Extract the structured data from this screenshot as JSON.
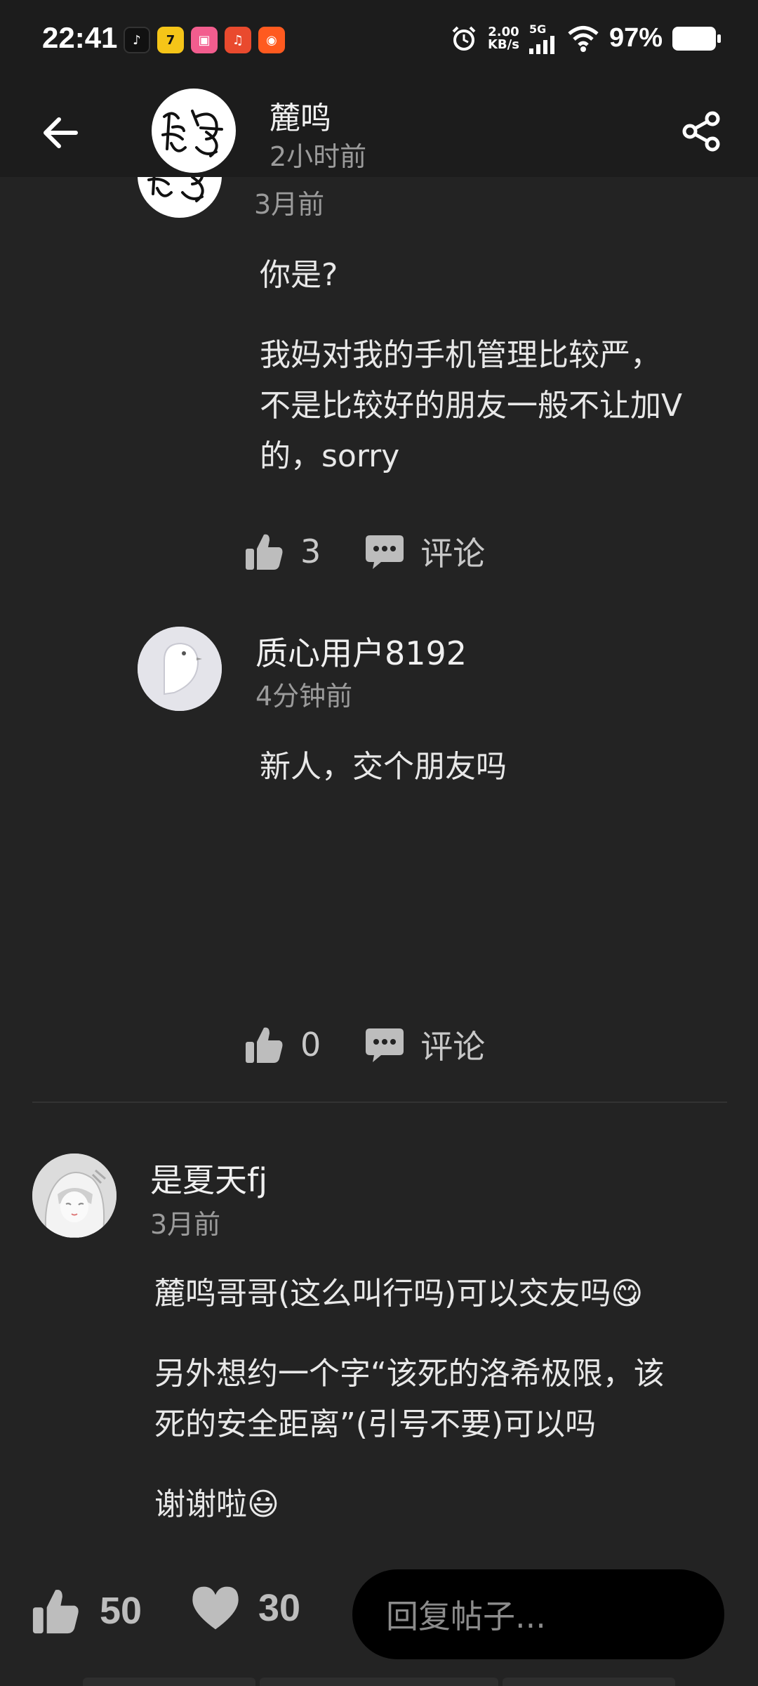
{
  "status_bar": {
    "time": "22:41",
    "speed_value": "2.00",
    "speed_unit": "KB/s",
    "network": "5G",
    "battery": "97%",
    "app_icons": [
      "tiktok-icon",
      "qimao-icon",
      "bilibili-icon",
      "ting-icon",
      "taobao-icon"
    ]
  },
  "header": {
    "author": "麓鸣",
    "time": "2小时前"
  },
  "thread": {
    "partial_time": "3月前",
    "first_comment": {
      "paragraphs": [
        "你是?",
        "我妈对我的手机管理比较严，",
        "不是比较好的朋友一般不让加V",
        "的，sorry"
      ],
      "likes": "3",
      "comment_label": "评论"
    },
    "reply": {
      "user": "质心用户8192",
      "time": "4分钟前",
      "text": "新人，交个朋友吗",
      "likes": "0",
      "comment_label": "评论"
    }
  },
  "post": {
    "user": "是夏天fj",
    "time": "3月前",
    "lines": [
      "麓鸣哥哥(这么叫行吗)可以交友吗😋",
      "另外想约一个字“该死的洛希极限，该",
      "死的安全距离”(引号不要)可以吗",
      "谢谢啦😃"
    ]
  },
  "bottom_bar": {
    "likes": "50",
    "favorites": "30",
    "reply_placeholder": "回复帖子..."
  },
  "colors": {
    "background": "#232323",
    "header": "#1c1c1c",
    "muted_text": "#9b9b9b"
  }
}
